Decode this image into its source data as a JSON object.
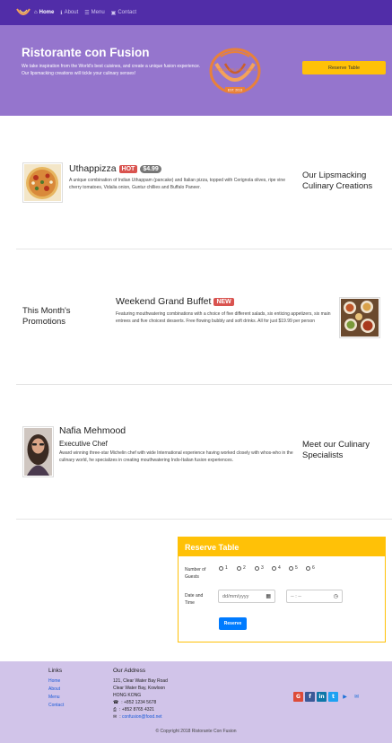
{
  "nav": {
    "items": [
      {
        "label": "Home",
        "icon": "home-icon",
        "active": true
      },
      {
        "label": "About",
        "icon": "info-icon",
        "active": false
      },
      {
        "label": "Menu",
        "icon": "list-icon",
        "active": false
      },
      {
        "label": "Contact",
        "icon": "address-card-icon",
        "active": false
      }
    ]
  },
  "jumbotron": {
    "title": "Ristorante con Fusion",
    "text": "We take inspiration from the World's best cuisines, and create a unique fusion experience. Our lipsmacking creations will tickle your culinary senses!",
    "button": "Reserve Table",
    "logo_text": "RISTORANTE CON FUSION",
    "logo_est": "EST. 2013"
  },
  "dish": {
    "name": "Uthappizza",
    "label": "HOT",
    "price": "$4.99",
    "description": "A unique combination of Indian Uthappam (pancake) and Italian pizza, topped with Cerignola olives, ripe vine cherry tomatoes, Vidalia onion, Guntur chillies and Buffalo Paneer.",
    "side_heading": "Our Lipsmacking Culinary Creations"
  },
  "promotion": {
    "side_heading": "This Month's Promotions",
    "name": "Weekend Grand Buffet",
    "label": "NEW",
    "description": "Featuring mouthwatering combinations with a choice of five different salads, six enticing appetizers, six main entrees and five choicest desserts. Free flowing bubbly and soft drinks. All for just $19.99 per person"
  },
  "leader": {
    "name": "Nafia Mehmood",
    "designation": "Executive Chef",
    "description": "Award winning three-star Michelin chef with wide International experience having worked closely with whos-who in the culinary world, he specializes in creating mouthwatering Indo-Italian fusion experiences.",
    "side_heading": "Meet our Culinary Specialists"
  },
  "reserve": {
    "title": "Reserve Table",
    "guests_label": "Number of Guests",
    "guest_options": [
      "1",
      "2",
      "3",
      "4",
      "5",
      "6"
    ],
    "datetime_label": "Date and Time",
    "date_placeholder": "dd/mm/yyyy",
    "time_placeholder": "-- : --",
    "submit": "Reserve"
  },
  "footer": {
    "links_heading": "Links",
    "links": [
      "Home",
      "About",
      "Menu",
      "Contact"
    ],
    "address_heading": "Our Address",
    "address": [
      "121, Clear Water Bay Road",
      "Clear Water Bay, Kowloon",
      "HONG KONG"
    ],
    "phone": ": +852 1234 5678",
    "fax": ": +852 8765 4321",
    "email": "confusion@food.net",
    "copyright": "© Copyright 2018 Ristorante Con Fusion",
    "social": [
      "google-plus-icon",
      "facebook-icon",
      "linkedin-icon",
      "twitter-icon",
      "youtube-icon",
      "mail-icon"
    ]
  },
  "colors": {
    "navbar": "#512DA8",
    "jumbotron": "#9575CD",
    "footer": "#D1C4E9",
    "accent": "#FFC107",
    "primary_button": "#007bff"
  }
}
